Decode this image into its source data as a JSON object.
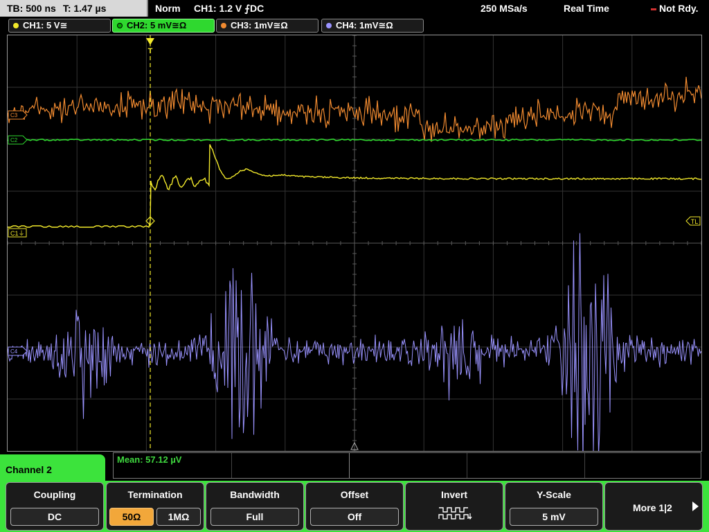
{
  "topbar": {
    "timebase": "TB: 500 ns",
    "trigger_time": "T: 1.47 µs",
    "mode": "Norm",
    "trigger_info": "CH1: 1.2 V ⨍DC",
    "sample_rate": "250 MSa/s",
    "acq_mode": "Real Time",
    "status": "Not Rdy."
  },
  "channels": [
    {
      "label": "CH1: 5 V≅",
      "color": "#f3ea2b"
    },
    {
      "label": "CH2: 5 mV≅Ω",
      "color": "#2fd82f"
    },
    {
      "label": "CH3: 1mV≅Ω",
      "color": "#f08a30"
    },
    {
      "label": "CH4: 1mV≅Ω",
      "color": "#9a93ff"
    }
  ],
  "grid_markers": {
    "trigger_marker": "T",
    "trigger_level": "TL",
    "ch1_ref": "C1⏚",
    "ch2_ref": "C2",
    "ch3_ref": "C3",
    "ch4_ref": "C4"
  },
  "measurement": {
    "label": "Mean: 57.12 µV"
  },
  "active_channel": "Channel 2",
  "softkeys": {
    "coupling": {
      "title": "Coupling",
      "value": "DC"
    },
    "termination": {
      "title": "Termination",
      "opt1": "50Ω",
      "opt2": "1MΩ"
    },
    "bandwidth": {
      "title": "Bandwidth",
      "value": "Full"
    },
    "offset": {
      "title": "Offset",
      "value": "Off"
    },
    "invert": {
      "title": "Invert",
      "icon": "invert-square-wave-icon"
    },
    "yscale": {
      "title": "Y-Scale",
      "value": "5 mV"
    },
    "more": {
      "label": "More 1|2"
    }
  }
}
